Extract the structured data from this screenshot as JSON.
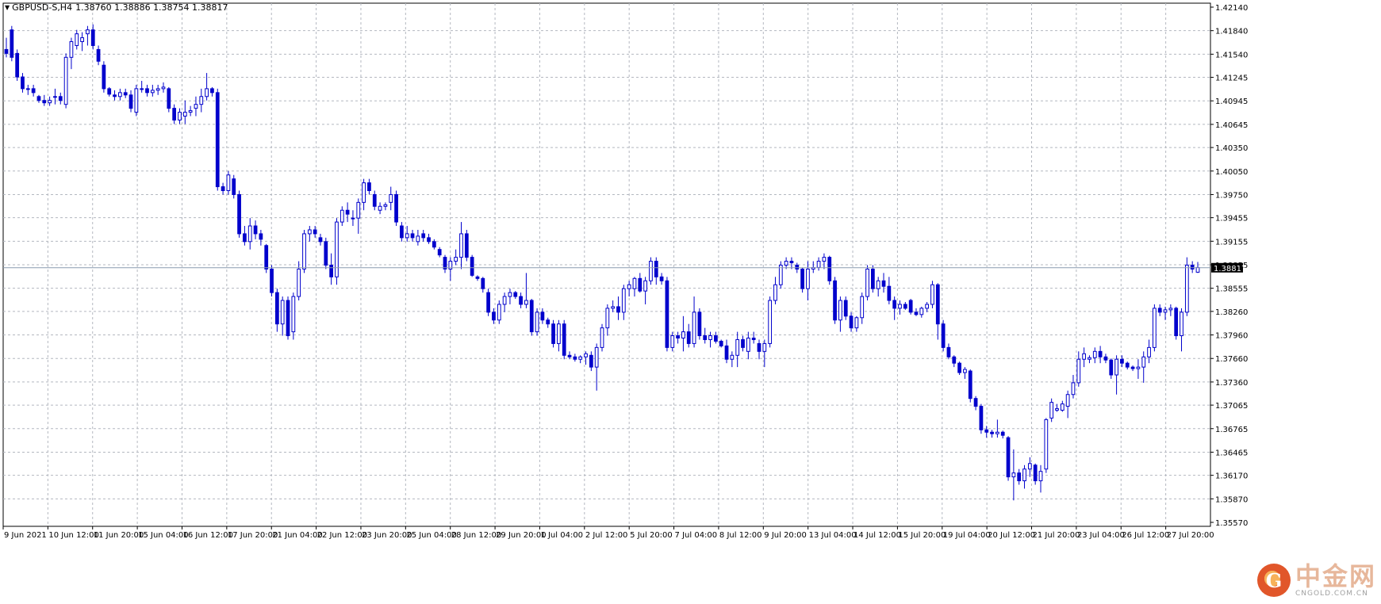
{
  "header": {
    "symbol": "GBPUSD-S,H4",
    "ohlc": "1.38760 1.38886 1.38754 1.38817"
  },
  "watermark": {
    "name": "中金网",
    "site": "CNGOLD.COM.CN"
  },
  "colors": {
    "candle": "#0000cc",
    "grid": "#b4b8c0",
    "background": "#ffffff",
    "price_line": "#8a9bb0"
  },
  "chart_data": {
    "type": "candlestick",
    "timeframe": "H4",
    "ylim": [
      1.3557,
      1.4214
    ],
    "y_ticks": [
      "1.42140",
      "1.41840",
      "1.41540",
      "1.41245",
      "1.40945",
      "1.40645",
      "1.40350",
      "1.40050",
      "1.39750",
      "1.39455",
      "1.39155",
      "1.38855",
      "1.38555",
      "1.38260",
      "1.37960",
      "1.37660",
      "1.37360",
      "1.37065",
      "1.36765",
      "1.36465",
      "1.36170",
      "1.35870",
      "1.35570"
    ],
    "x_ticks": [
      "9 Jun 2021",
      "10 Jun 12:00",
      "11 Jun 20:00",
      "15 Jun 04:00",
      "16 Jun 12:00",
      "17 Jun 20:00",
      "21 Jun 04:00",
      "22 Jun 12:00",
      "23 Jun 20:00",
      "25 Jun 04:00",
      "28 Jun 12:00",
      "29 Jun 20:00",
      "1 Jul 04:00",
      "2 Jul 12:00",
      "5 Jul 20:00",
      "7 Jul 04:00",
      "8 Jul 12:00",
      "9 Jul 20:00",
      "13 Jul 04:00",
      "14 Jul 12:00",
      "15 Jul 20:00",
      "19 Jul 04:00",
      "20 Jul 12:00",
      "21 Jul 20:00",
      "23 Jul 04:00",
      "26 Jul 12:00",
      "27 Jul 20:00"
    ],
    "current_price": "1.38817",
    "candles": [
      [
        1.416,
        1.4175,
        1.415,
        1.4155
      ],
      [
        1.4185,
        1.419,
        1.4145,
        1.415
      ],
      [
        1.4155,
        1.416,
        1.412,
        1.4125
      ],
      [
        1.4125,
        1.413,
        1.4105,
        1.411
      ],
      [
        1.411,
        1.4115,
        1.4102,
        1.411
      ],
      [
        1.411,
        1.4115,
        1.41,
        1.4105
      ],
      [
        1.41,
        1.4102,
        1.4092,
        1.4095
      ],
      [
        1.4095,
        1.4102,
        1.4088,
        1.4092
      ],
      [
        1.4092,
        1.41,
        1.4088,
        1.4095
      ],
      [
        1.41,
        1.411,
        1.409,
        1.41
      ],
      [
        1.41,
        1.4105,
        1.409,
        1.4095
      ],
      [
        1.409,
        1.4155,
        1.4085,
        1.415
      ],
      [
        1.415,
        1.4175,
        1.4135,
        1.417
      ],
      [
        1.4165,
        1.4185,
        1.416,
        1.418
      ],
      [
        1.417,
        1.4182,
        1.4158,
        1.4175
      ],
      [
        1.418,
        1.419,
        1.4165,
        1.4185
      ],
      [
        1.4185,
        1.4192,
        1.416,
        1.4165
      ],
      [
        1.416,
        1.4165,
        1.414,
        1.4145
      ],
      [
        1.414,
        1.4145,
        1.4105,
        1.411
      ],
      [
        1.411,
        1.4112,
        1.41,
        1.4103
      ],
      [
        1.4102,
        1.4108,
        1.4095,
        1.41
      ],
      [
        1.41,
        1.411,
        1.4095,
        1.4105
      ],
      [
        1.4105,
        1.411,
        1.4098,
        1.4102
      ],
      [
        1.4102,
        1.4108,
        1.408,
        1.4085
      ],
      [
        1.408,
        1.4115,
        1.4075,
        1.411
      ],
      [
        1.411,
        1.412,
        1.4105,
        1.411
      ],
      [
        1.411,
        1.4115,
        1.41,
        1.4105
      ],
      [
        1.4105,
        1.4115,
        1.41,
        1.4108
      ],
      [
        1.4108,
        1.4115,
        1.4102,
        1.411
      ],
      [
        1.411,
        1.4118,
        1.4105,
        1.4112
      ],
      [
        1.411,
        1.4112,
        1.408,
        1.4085
      ],
      [
        1.4085,
        1.409,
        1.4065,
        1.407
      ],
      [
        1.407,
        1.4085,
        1.4065,
        1.408
      ],
      [
        1.4075,
        1.4095,
        1.4065,
        1.408
      ],
      [
        1.408,
        1.4088,
        1.4075,
        1.4082
      ],
      [
        1.4085,
        1.41,
        1.4075,
        1.409
      ],
      [
        1.409,
        1.411,
        1.408,
        1.41
      ],
      [
        1.41,
        1.413,
        1.4095,
        1.411
      ],
      [
        1.411,
        1.4112,
        1.41,
        1.4105
      ],
      [
        1.4105,
        1.411,
        1.398,
        1.3985
      ],
      [
        1.3985,
        1.399,
        1.3975,
        1.398
      ],
      [
        1.398,
        1.4005,
        1.3975,
        1.4
      ],
      [
        1.3995,
        1.4,
        1.397,
        1.3975
      ],
      [
        1.3975,
        1.398,
        1.392,
        1.3925
      ],
      [
        1.3925,
        1.3935,
        1.391,
        1.3915
      ],
      [
        1.3915,
        1.3945,
        1.3905,
        1.3935
      ],
      [
        1.3935,
        1.3942,
        1.3918,
        1.3925
      ],
      [
        1.3925,
        1.393,
        1.391,
        1.3918
      ],
      [
        1.391,
        1.3912,
        1.3875,
        1.388
      ],
      [
        1.388,
        1.3885,
        1.3845,
        1.385
      ],
      [
        1.385,
        1.3855,
        1.38,
        1.381
      ],
      [
        1.381,
        1.3845,
        1.3795,
        1.384
      ],
      [
        1.384,
        1.3845,
        1.379,
        1.3795
      ],
      [
        1.38,
        1.385,
        1.379,
        1.3845
      ],
      [
        1.3845,
        1.389,
        1.384,
        1.388
      ],
      [
        1.388,
        1.393,
        1.3875,
        1.3925
      ],
      [
        1.3925,
        1.3935,
        1.3915,
        1.393
      ],
      [
        1.393,
        1.3935,
        1.392,
        1.3925
      ],
      [
        1.392,
        1.3925,
        1.391,
        1.3915
      ],
      [
        1.3915,
        1.392,
        1.388,
        1.3885
      ],
      [
        1.3885,
        1.39,
        1.386,
        1.387
      ],
      [
        1.387,
        1.3945,
        1.386,
        1.394
      ],
      [
        1.394,
        1.396,
        1.3935,
        1.3955
      ],
      [
        1.3955,
        1.3965,
        1.394,
        1.395
      ],
      [
        1.3945,
        1.3955,
        1.3935,
        1.3945
      ],
      [
        1.3945,
        1.397,
        1.3925,
        1.3965
      ],
      [
        1.3965,
        1.3995,
        1.3955,
        1.399
      ],
      [
        1.399,
        1.3995,
        1.3975,
        1.398
      ],
      [
        1.3975,
        1.398,
        1.3955,
        1.396
      ],
      [
        1.3955,
        1.3965,
        1.395,
        1.396
      ],
      [
        1.396,
        1.3965,
        1.3955,
        1.3962
      ],
      [
        1.3965,
        1.3985,
        1.3955,
        1.3975
      ],
      [
        1.3975,
        1.398,
        1.3935,
        1.394
      ],
      [
        1.3935,
        1.394,
        1.3915,
        1.392
      ],
      [
        1.392,
        1.3935,
        1.3915,
        1.3925
      ],
      [
        1.3925,
        1.393,
        1.3915,
        1.392
      ],
      [
        1.3915,
        1.393,
        1.391,
        1.3922
      ],
      [
        1.3925,
        1.393,
        1.3915,
        1.392
      ],
      [
        1.392,
        1.3925,
        1.3912,
        1.3915
      ],
      [
        1.3915,
        1.3918,
        1.3905,
        1.3908
      ],
      [
        1.3905,
        1.3908,
        1.3895,
        1.3898
      ],
      [
        1.3895,
        1.3898,
        1.3875,
        1.388
      ],
      [
        1.388,
        1.3895,
        1.3865,
        1.389
      ],
      [
        1.389,
        1.3905,
        1.3885,
        1.3895
      ],
      [
        1.3895,
        1.394,
        1.388,
        1.3925
      ],
      [
        1.3925,
        1.393,
        1.389,
        1.3895
      ],
      [
        1.3895,
        1.3898,
        1.387,
        1.3872
      ],
      [
        1.387,
        1.3872,
        1.3865,
        1.3868
      ],
      [
        1.3868,
        1.387,
        1.385,
        1.3855
      ],
      [
        1.385,
        1.3855,
        1.382,
        1.3825
      ],
      [
        1.3825,
        1.383,
        1.381,
        1.3815
      ],
      [
        1.3815,
        1.384,
        1.381,
        1.3835
      ],
      [
        1.3835,
        1.385,
        1.3825,
        1.3845
      ],
      [
        1.3845,
        1.3855,
        1.3835,
        1.385
      ],
      [
        1.385,
        1.3852,
        1.3842,
        1.3845
      ],
      [
        1.3845,
        1.385,
        1.383,
        1.3835
      ],
      [
        1.3835,
        1.3875,
        1.383,
        1.384
      ],
      [
        1.384,
        1.3842,
        1.3795,
        1.38
      ],
      [
        1.38,
        1.383,
        1.3795,
        1.3825
      ],
      [
        1.3825,
        1.383,
        1.381,
        1.3815
      ],
      [
        1.3815,
        1.3818,
        1.3805,
        1.381
      ],
      [
        1.381,
        1.3815,
        1.378,
        1.3785
      ],
      [
        1.3785,
        1.3815,
        1.3775,
        1.381
      ],
      [
        1.381,
        1.3815,
        1.3765,
        1.377
      ],
      [
        1.377,
        1.3775,
        1.3765,
        1.3768
      ],
      [
        1.3768,
        1.3772,
        1.3762,
        1.3765
      ],
      [
        1.3765,
        1.377,
        1.376,
        1.3768
      ],
      [
        1.3768,
        1.3775,
        1.3758,
        1.3772
      ],
      [
        1.377,
        1.3775,
        1.375,
        1.3755
      ],
      [
        1.3755,
        1.3785,
        1.3725,
        1.378
      ],
      [
        1.378,
        1.381,
        1.3775,
        1.3805
      ],
      [
        1.3805,
        1.3835,
        1.3795,
        1.383
      ],
      [
        1.383,
        1.384,
        1.3825,
        1.3832
      ],
      [
        1.3832,
        1.3845,
        1.3815,
        1.3825
      ],
      [
        1.3825,
        1.386,
        1.3815,
        1.3855
      ],
      [
        1.3855,
        1.3865,
        1.3845,
        1.386
      ],
      [
        1.3855,
        1.387,
        1.3845,
        1.3868
      ],
      [
        1.3868,
        1.3875,
        1.385,
        1.3852
      ],
      [
        1.3852,
        1.387,
        1.3835,
        1.3865
      ],
      [
        1.3865,
        1.3895,
        1.386,
        1.389
      ],
      [
        1.389,
        1.3895,
        1.386,
        1.387
      ],
      [
        1.387,
        1.3875,
        1.386,
        1.3865
      ],
      [
        1.3865,
        1.387,
        1.3775,
        1.378
      ],
      [
        1.378,
        1.38,
        1.3775,
        1.3795
      ],
      [
        1.3795,
        1.38,
        1.3785,
        1.3792
      ],
      [
        1.3792,
        1.382,
        1.3775,
        1.38
      ],
      [
        1.38,
        1.381,
        1.378,
        1.3785
      ],
      [
        1.3785,
        1.3845,
        1.378,
        1.3825
      ],
      [
        1.3825,
        1.383,
        1.379,
        1.3795
      ],
      [
        1.3795,
        1.3805,
        1.3785,
        1.379
      ],
      [
        1.379,
        1.38,
        1.378,
        1.3795
      ],
      [
        1.3795,
        1.38,
        1.3785,
        1.3788
      ],
      [
        1.3788,
        1.379,
        1.378,
        1.3782
      ],
      [
        1.3782,
        1.379,
        1.376,
        1.3765
      ],
      [
        1.3765,
        1.3775,
        1.3755,
        1.377
      ],
      [
        1.377,
        1.38,
        1.3755,
        1.379
      ],
      [
        1.379,
        1.3795,
        1.3775,
        1.378
      ],
      [
        1.3775,
        1.38,
        1.3765,
        1.3792
      ],
      [
        1.3792,
        1.38,
        1.3785,
        1.379
      ],
      [
        1.3785,
        1.379,
        1.3765,
        1.3775
      ],
      [
        1.3775,
        1.379,
        1.3755,
        1.3785
      ],
      [
        1.3785,
        1.3845,
        1.378,
        1.384
      ],
      [
        1.384,
        1.387,
        1.3835,
        1.386
      ],
      [
        1.386,
        1.389,
        1.3855,
        1.3885
      ],
      [
        1.3885,
        1.3895,
        1.388,
        1.389
      ],
      [
        1.389,
        1.3895,
        1.388,
        1.3888
      ],
      [
        1.3885,
        1.3888,
        1.3875,
        1.388
      ],
      [
        1.388,
        1.3882,
        1.385,
        1.3855
      ],
      [
        1.3855,
        1.389,
        1.384,
        1.388
      ],
      [
        1.388,
        1.389,
        1.3875,
        1.3882
      ],
      [
        1.3882,
        1.3895,
        1.3878,
        1.389
      ],
      [
        1.389,
        1.39,
        1.388,
        1.3895
      ],
      [
        1.3895,
        1.3897,
        1.386,
        1.3865
      ],
      [
        1.3865,
        1.387,
        1.381,
        1.3815
      ],
      [
        1.3815,
        1.3845,
        1.38,
        1.384
      ],
      [
        1.384,
        1.3845,
        1.3815,
        1.382
      ],
      [
        1.382,
        1.3825,
        1.38,
        1.3805
      ],
      [
        1.3805,
        1.382,
        1.38,
        1.3818
      ],
      [
        1.3818,
        1.385,
        1.381,
        1.3845
      ],
      [
        1.3845,
        1.3885,
        1.384,
        1.388
      ],
      [
        1.388,
        1.3885,
        1.385,
        1.3855
      ],
      [
        1.3855,
        1.387,
        1.3845,
        1.3865
      ],
      [
        1.3865,
        1.3875,
        1.385,
        1.3858
      ],
      [
        1.3858,
        1.387,
        1.3835,
        1.384
      ],
      [
        1.384,
        1.3845,
        1.3815,
        1.383
      ],
      [
        1.383,
        1.384,
        1.3822,
        1.3835
      ],
      [
        1.3835,
        1.3838,
        1.3828,
        1.383
      ],
      [
        1.384,
        1.3842,
        1.3822,
        1.3825
      ],
      [
        1.3825,
        1.383,
        1.382,
        1.3822
      ],
      [
        1.3822,
        1.3832,
        1.3818,
        1.383
      ],
      [
        1.383,
        1.3838,
        1.3825,
        1.3835
      ],
      [
        1.3835,
        1.3865,
        1.383,
        1.386
      ],
      [
        1.386,
        1.3862,
        1.379,
        1.381
      ],
      [
        1.381,
        1.3815,
        1.3775,
        1.378
      ],
      [
        1.378,
        1.3785,
        1.3765,
        1.3768
      ],
      [
        1.3768,
        1.377,
        1.3755,
        1.376
      ],
      [
        1.376,
        1.3762,
        1.3745,
        1.3748
      ],
      [
        1.3748,
        1.3755,
        1.374,
        1.3752
      ],
      [
        1.375,
        1.3752,
        1.371,
        1.3715
      ],
      [
        1.3715,
        1.3718,
        1.37,
        1.3705
      ],
      [
        1.3705,
        1.3708,
        1.367,
        1.3675
      ],
      [
        1.3675,
        1.368,
        1.3665,
        1.3672
      ],
      [
        1.3672,
        1.3675,
        1.3665,
        1.367
      ],
      [
        1.367,
        1.3688,
        1.3665,
        1.3672
      ],
      [
        1.3672,
        1.3674,
        1.3664,
        1.3668
      ],
      [
        1.3665,
        1.3667,
        1.361,
        1.3615
      ],
      [
        1.3615,
        1.365,
        1.3585,
        1.362
      ],
      [
        1.362,
        1.3625,
        1.3605,
        1.361
      ],
      [
        1.361,
        1.363,
        1.36,
        1.3625
      ],
      [
        1.3625,
        1.364,
        1.3615,
        1.3632
      ],
      [
        1.363,
        1.3632,
        1.3605,
        1.361
      ],
      [
        1.361,
        1.363,
        1.3595,
        1.3622
      ],
      [
        1.3625,
        1.369,
        1.362,
        1.3688
      ],
      [
        1.369,
        1.3715,
        1.3685,
        1.371
      ],
      [
        1.37,
        1.3708,
        1.3698,
        1.3702
      ],
      [
        1.37,
        1.3712,
        1.3698,
        1.3708
      ],
      [
        1.3705,
        1.3725,
        1.369,
        1.372
      ],
      [
        1.372,
        1.3745,
        1.3715,
        1.3735
      ],
      [
        1.3735,
        1.3775,
        1.373,
        1.3765
      ],
      [
        1.3765,
        1.378,
        1.3755,
        1.3772
      ],
      [
        1.3765,
        1.377,
        1.376,
        1.3767
      ],
      [
        1.3767,
        1.378,
        1.376,
        1.3775
      ],
      [
        1.3775,
        1.3782,
        1.376,
        1.3768
      ],
      [
        1.3768,
        1.3772,
        1.376,
        1.3764
      ],
      [
        1.3764,
        1.3766,
        1.374,
        1.3745
      ],
      [
        1.3745,
        1.377,
        1.372,
        1.3765
      ],
      [
        1.3765,
        1.377,
        1.3755,
        1.376
      ],
      [
        1.376,
        1.3762,
        1.3752,
        1.3755
      ],
      [
        1.3755,
        1.3757,
        1.375,
        1.3753
      ],
      [
        1.3753,
        1.3765,
        1.374,
        1.3755
      ],
      [
        1.3755,
        1.3775,
        1.3735,
        1.3768
      ],
      [
        1.3768,
        1.379,
        1.376,
        1.378
      ],
      [
        1.378,
        1.3835,
        1.3775,
        1.383
      ],
      [
        1.383,
        1.3835,
        1.382,
        1.3825
      ],
      [
        1.3825,
        1.3832,
        1.3815,
        1.3828
      ],
      [
        1.3828,
        1.3835,
        1.382,
        1.383
      ],
      [
        1.383,
        1.3832,
        1.379,
        1.3795
      ],
      [
        1.3795,
        1.383,
        1.3775,
        1.3825
      ],
      [
        1.3825,
        1.3895,
        1.382,
        1.3885
      ],
      [
        1.3885,
        1.389,
        1.3875,
        1.388
      ],
      [
        1.3876,
        1.3889,
        1.3875,
        1.3882
      ]
    ]
  }
}
